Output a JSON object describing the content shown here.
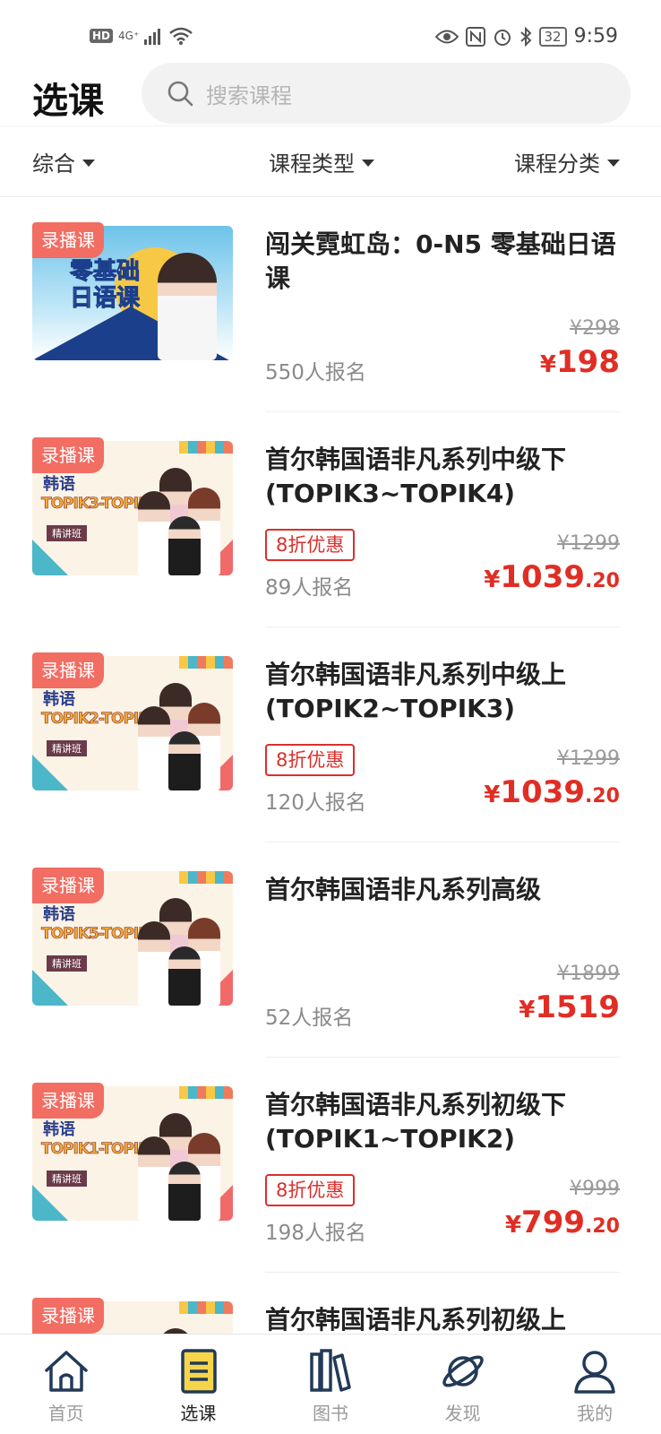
{
  "status_bar": {
    "hd": "HD",
    "network": "4G⁺",
    "battery": "32",
    "time": "9:59"
  },
  "header": {
    "title": "选课",
    "search_placeholder": "搜索课程"
  },
  "filters": [
    "综合",
    "课程类型",
    "课程分类"
  ],
  "courses": [
    {
      "tag": "录播课",
      "title": "闯关霓虹岛：0-N5 零基础日语课",
      "thumb": {
        "type": "jp",
        "line1": "零基础",
        "line2": "日语课"
      },
      "discount": "",
      "old_price": "¥298",
      "enrolled": "550人报名",
      "price": {
        "currency": "¥",
        "integer": "198",
        "decimal": ""
      }
    },
    {
      "tag": "录播课",
      "title": "首尔韩国语非凡系列中级下(TOPIK3~TOPIK4)",
      "thumb": {
        "type": "kr",
        "lang": "韩语",
        "level": "TOPIK3-TOPIK4",
        "class": "精讲班"
      },
      "discount": "8折优惠",
      "old_price": "¥1299",
      "enrolled": "89人报名",
      "price": {
        "currency": "¥",
        "integer": "1039",
        "decimal": ".20"
      }
    },
    {
      "tag": "录播课",
      "title": "首尔韩国语非凡系列中级上(TOPIK2~TOPIK3)",
      "thumb": {
        "type": "kr",
        "lang": "韩语",
        "level": "TOPIK2-TOPIK3",
        "class": "精讲班"
      },
      "discount": "8折优惠",
      "old_price": "¥1299",
      "enrolled": "120人报名",
      "price": {
        "currency": "¥",
        "integer": "1039",
        "decimal": ".20"
      }
    },
    {
      "tag": "录播课",
      "title": "首尔韩国语非凡系列高级",
      "thumb": {
        "type": "kr",
        "lang": "韩语",
        "level": "TOPIK5-TOPIK6",
        "class": "精讲班"
      },
      "discount": "",
      "old_price": "¥1899",
      "enrolled": "52人报名",
      "price": {
        "currency": "¥",
        "integer": "1519",
        "decimal": ""
      }
    },
    {
      "tag": "录播课",
      "title": "首尔韩国语非凡系列初级下(TOPIK1~TOPIK2)",
      "thumb": {
        "type": "kr",
        "lang": "韩语",
        "level": "TOPIK1-TOPIK2",
        "class": "精讲班"
      },
      "discount": "8折优惠",
      "old_price": "¥999",
      "enrolled": "198人报名",
      "price": {
        "currency": "¥",
        "integer": "799",
        "decimal": ".20"
      }
    },
    {
      "tag": "录播课",
      "title": "首尔韩国语非凡系列初级上",
      "thumb": {
        "type": "kr",
        "lang": "",
        "level": "",
        "class": ""
      },
      "discount": "",
      "old_price": "",
      "enrolled": "",
      "price": {
        "currency": "",
        "integer": "",
        "decimal": ""
      }
    }
  ],
  "tabs": [
    {
      "label": "首页",
      "icon": "home-icon",
      "active": false
    },
    {
      "label": "选课",
      "icon": "course-list-icon",
      "active": true
    },
    {
      "label": "图书",
      "icon": "books-icon",
      "active": false
    },
    {
      "label": "发现",
      "icon": "planet-icon",
      "active": false
    },
    {
      "label": "我的",
      "icon": "user-icon",
      "active": false
    }
  ],
  "colors": {
    "accent_red": "#e02e24",
    "tag_coral": "#f26d62",
    "active_tab_yellow": "#f7d54a"
  }
}
